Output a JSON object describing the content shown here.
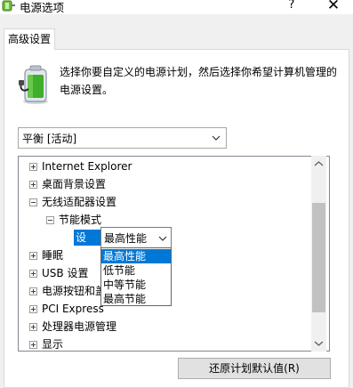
{
  "window": {
    "title": "电源选项",
    "help_glyph": "?",
    "close_glyph": "✕"
  },
  "tabs": [
    {
      "label": "高级设置",
      "active": true
    }
  ],
  "intro": {
    "icon": "power-plan-icon",
    "text": "选择你要自定义的电源计划，然后选择你希望计算机管理的电源设置。"
  },
  "plan_select": {
    "value": "平衡 [活动]"
  },
  "tree": {
    "items": [
      {
        "label": "Internet Explorer",
        "expander": "plus"
      },
      {
        "label": "桌面背景设置",
        "expander": "plus"
      },
      {
        "label": "无线适配器设置",
        "expander": "minus"
      },
      {
        "label": "节能模式",
        "expander": "minus"
      },
      {
        "label": "睡眠",
        "expander": "plus"
      },
      {
        "label": "USB 设置",
        "expander": "plus"
      },
      {
        "label": "电源按钮和盖",
        "expander": "plus"
      },
      {
        "label": "PCI Express",
        "expander": "plus"
      },
      {
        "label": "处理器电源管理",
        "expander": "plus"
      },
      {
        "label": "显示",
        "expander": "plus"
      }
    ],
    "setting": {
      "label": "设置:",
      "value": "最高性能"
    }
  },
  "dropdown": {
    "options": [
      "最高性能",
      "低节能",
      "中等节能",
      "最高节能"
    ],
    "selected_index": 0
  },
  "buttons": {
    "restore": "还原计划默认值(R)"
  },
  "colors": {
    "accent": "#0078d7",
    "battery_green": "#3fae2a",
    "dialog_bg": "#f0f0f0"
  }
}
